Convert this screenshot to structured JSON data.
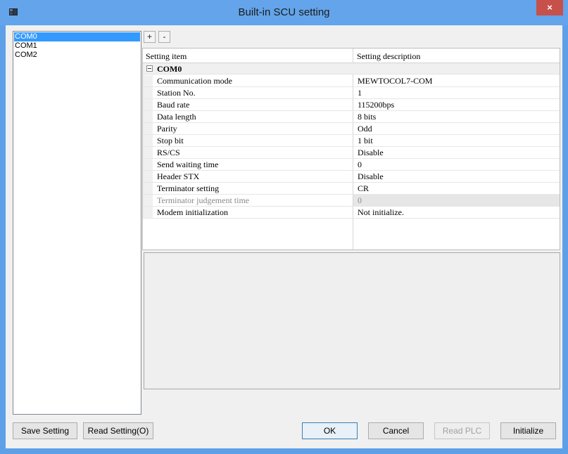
{
  "window": {
    "title": "Built-in SCU setting",
    "close_glyph": "×",
    "accent": "#63a4ea"
  },
  "ports": [
    "COM0",
    "COM1",
    "COM2"
  ],
  "selected_port": "COM0",
  "toolbar": {
    "expand_label": "+",
    "collapse_label": "-"
  },
  "grid": {
    "columns": [
      "Setting item",
      "Setting description"
    ],
    "group": "COM0",
    "rows": [
      {
        "item": "Communication mode",
        "value": "MEWTOCOL7-COM"
      },
      {
        "item": "Station No.",
        "value": "1"
      },
      {
        "item": "Baud rate",
        "value": "115200bps"
      },
      {
        "item": "Data length",
        "value": "8 bits"
      },
      {
        "item": "Parity",
        "value": "Odd"
      },
      {
        "item": "Stop bit",
        "value": "1 bit"
      },
      {
        "item": "RS/CS",
        "value": "Disable"
      },
      {
        "item": "Send waiting time",
        "value": "0"
      },
      {
        "item": "Header STX",
        "value": "Disable"
      },
      {
        "item": "Terminator setting",
        "value": "CR"
      },
      {
        "item": "Terminator judgement time",
        "value": "0",
        "disabled": true
      },
      {
        "item": "Modem initialization",
        "value": "Not initialize."
      }
    ]
  },
  "buttons": {
    "save": "Save Setting",
    "read": "Read Setting(O)",
    "ok": "OK",
    "cancel": "Cancel",
    "read_plc": "Read PLC",
    "initialize": "Initialize"
  }
}
